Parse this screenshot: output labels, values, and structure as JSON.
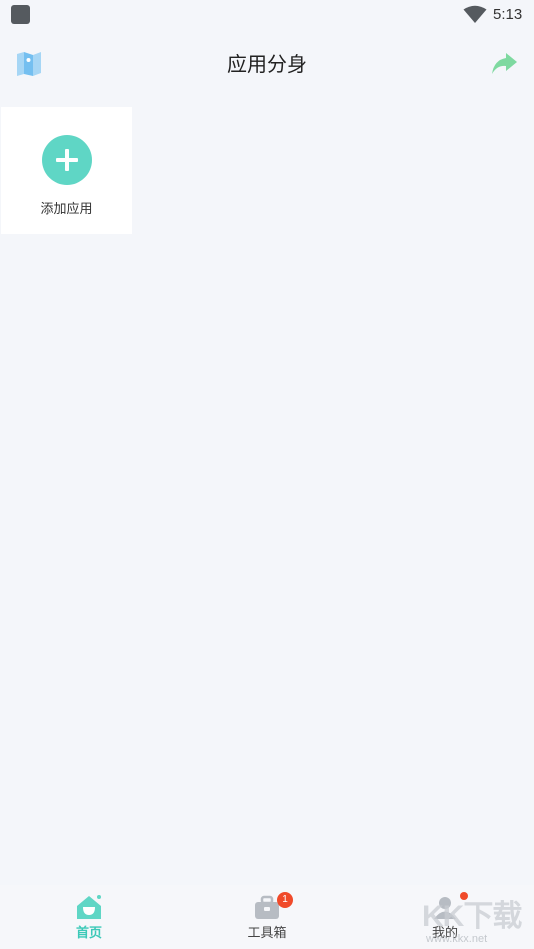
{
  "status_bar": {
    "time": "5:13",
    "icons": [
      "app-notification-icon",
      "wifi-icon"
    ]
  },
  "header": {
    "title": "应用分身",
    "left_icon": "map-icon",
    "right_icon": "share-arrow-icon",
    "share_color": "#7ed9a0"
  },
  "apps": {
    "add_label": "添加应用",
    "accent": "#5fd6c5"
  },
  "bottom_nav": {
    "items": [
      {
        "label": "首页",
        "icon": "home-icon",
        "active": true
      },
      {
        "label": "工具箱",
        "icon": "toolbox-icon",
        "badge": "1"
      },
      {
        "label": "我的",
        "icon": "profile-icon",
        "dot": true
      }
    ],
    "active_color": "#3cc9b8",
    "badge_color": "#f04a2a"
  },
  "watermark": {
    "brand": "KK下载",
    "url": "www.kkx.net"
  }
}
